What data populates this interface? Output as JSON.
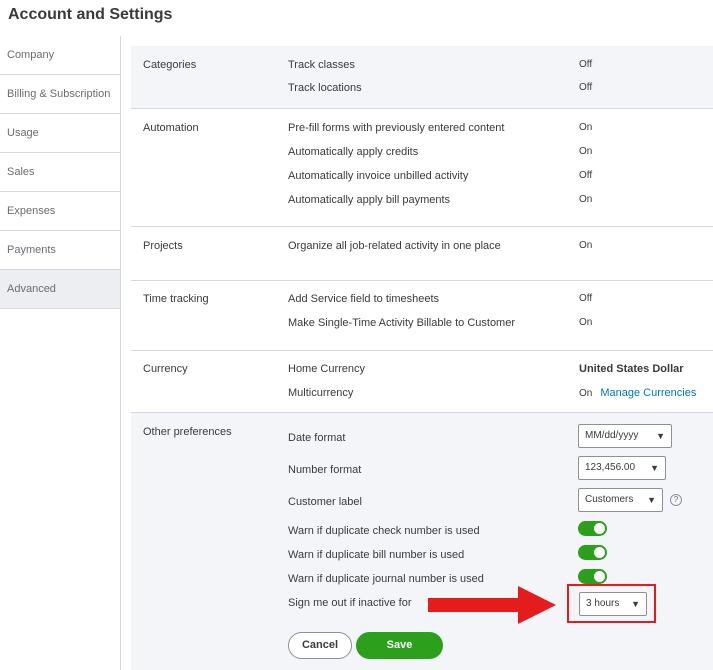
{
  "page": {
    "title": "Account and Settings"
  },
  "sidebar": {
    "items": [
      {
        "label": "Company"
      },
      {
        "label": "Billing & Subscription"
      },
      {
        "label": "Usage"
      },
      {
        "label": "Sales"
      },
      {
        "label": "Expenses"
      },
      {
        "label": "Payments"
      },
      {
        "label": "Advanced",
        "active": true
      }
    ]
  },
  "sections": {
    "categories": {
      "title": "Categories",
      "rows": [
        {
          "label": "Track classes",
          "value": "Off"
        },
        {
          "label": "Track locations",
          "value": "Off"
        }
      ]
    },
    "automation": {
      "title": "Automation",
      "rows": [
        {
          "label": "Pre-fill forms with previously entered content",
          "value": "On"
        },
        {
          "label": "Automatically apply credits",
          "value": "On"
        },
        {
          "label": "Automatically invoice unbilled activity",
          "value": "Off"
        },
        {
          "label": "Automatically apply bill payments",
          "value": "On"
        }
      ]
    },
    "projects": {
      "title": "Projects",
      "rows": [
        {
          "label": "Organize all job-related activity in one place",
          "value": "On"
        }
      ]
    },
    "time_tracking": {
      "title": "Time tracking",
      "rows": [
        {
          "label": "Add Service field to timesheets",
          "value": "Off"
        },
        {
          "label": "Make Single-Time Activity Billable to Customer",
          "value": "On"
        }
      ]
    },
    "currency": {
      "title": "Currency",
      "home_label": "Home Currency",
      "home_value": "United States Dollar",
      "multi_label": "Multicurrency",
      "multi_value": "On",
      "manage_link": "Manage Currencies"
    },
    "other": {
      "title": "Other preferences",
      "date_format": {
        "label": "Date format",
        "value": "MM/dd/yyyy"
      },
      "number_format": {
        "label": "Number format",
        "value": "123,456.00"
      },
      "customer_label": {
        "label": "Customer label",
        "value": "Customers",
        "help": "?"
      },
      "toggles": [
        {
          "label": "Warn if duplicate check number is used",
          "state": "on"
        },
        {
          "label": "Warn if duplicate bill number is used",
          "state": "on"
        },
        {
          "label": "Warn if duplicate journal number is used",
          "state": "on"
        }
      ],
      "sign_out": {
        "label": "Sign me out if inactive for",
        "value": "3 hours"
      }
    }
  },
  "actions": {
    "cancel": "Cancel",
    "save": "Save"
  },
  "colors": {
    "accent_green": "#2ca01c",
    "link_blue": "#0077c5",
    "annotation_red": "#e41c1c",
    "gray_bg": "#f4f5f8"
  },
  "icons": {
    "dropdown": "caret-down-icon",
    "help": "question-circle-icon",
    "annotation": "red-arrow-icon"
  }
}
